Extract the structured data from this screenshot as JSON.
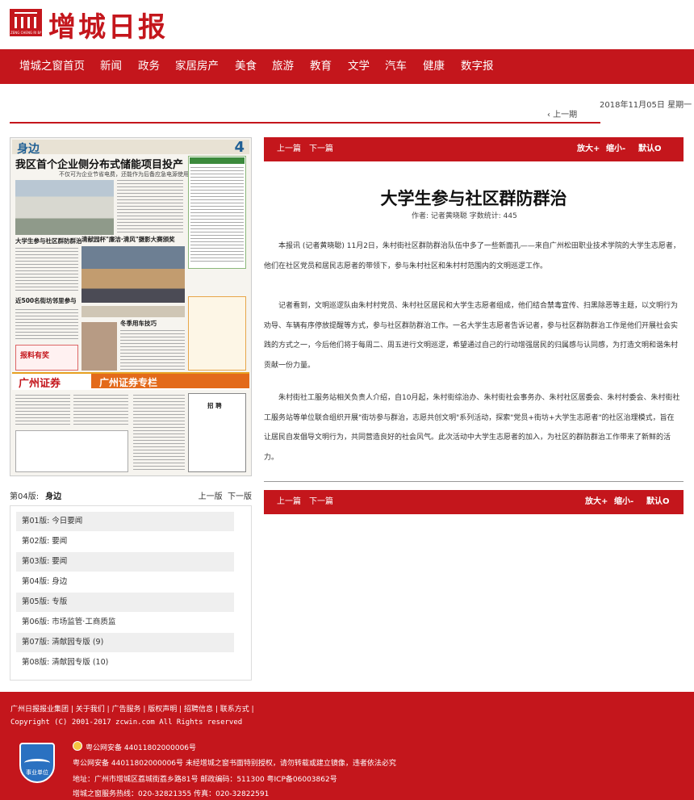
{
  "logo": {
    "title": "增城日报",
    "sub": "ZENG CHENG RI BAO"
  },
  "nav": [
    "增城之窗首页",
    "新闻",
    "政务",
    "家居房产",
    "美食",
    "旅游",
    "教育",
    "文学",
    "汽车",
    "健康",
    "数字报"
  ],
  "date": "2018年11月05日 星期一",
  "prev_issue": "‹ 上一期",
  "paper": {
    "section": "身边",
    "page_num": "4",
    "headline": "我区首个企业侧分布式储能项目投产",
    "subhead": "不仅可为企业节省电费，还能作为后备应急电源使用",
    "t1": "大学生参与社区群防群治",
    "t2": "清献园杯\"廉洁·清风\"摄影大赛颁奖",
    "t3": "近500名街坊邻里参与",
    "t4": "冬季用车技巧",
    "t5": "广州证券",
    "t6": "广州证券专栏",
    "t7": "招 聘",
    "t8": "报料有奖"
  },
  "paper_meta": {
    "edition_label": "第04版:",
    "edition_name": "身边",
    "prev": "上一版",
    "next": "下一版"
  },
  "editions": [
    "第01版: 今日要闻",
    "第02版: 要闻",
    "第03版: 要闻",
    "第04版: 身边",
    "第05版: 专版",
    "第06版: 市场监管·工商质监",
    "第07版: 清献园专版 (9)",
    "第08版: 清献园专版 (10)"
  ],
  "toolbar": {
    "prev_article": "上一篇",
    "next_article": "下一篇",
    "zoom_in": "放大+",
    "zoom_out": "缩小-",
    "default": "默认O"
  },
  "article": {
    "title": "大学生参与社区群防群治",
    "byline": "作者: 记者黄晓聪 字数统计: 445",
    "p1": "本报讯 (记者黄晓聪) 11月2日，朱村街社区群防群治队伍中多了一些新面孔——来自广州松田职业技术学院的大学生志愿者，他们在社区党员和居民志愿者的带领下，参与朱村社区和朱村村范围内的文明巡逻工作。",
    "p2": "记者看到，文明巡逻队由朱村村党员、朱村社区居民和大学生志愿者组成，他们结合禁毒宣传、扫黑除恶等主题，以文明行为劝导、车辆有序停放提醒等方式，参与社区群防群治工作。一名大学生志愿者告诉记者，参与社区群防群治工作是他们开展社会实践的方式之一，今后他们将于每周二、周五进行文明巡逻，希望通过自己的行动增强居民的归属感与认同感，为打造文明和谐朱村贡献一份力量。",
    "p3": "朱村街社工服务站相关负责人介绍，自10月起，朱村街综治办、朱村街社会事务办、朱村社区居委会、朱村村委会、朱村街社工服务站等单位联合组织开展\"街坊参与群治，志愿共创文明\"系列活动，探索\"党员+街坊+大学生志愿者\"的社区治理模式，旨在让居民自发倡导文明行为，共同营造良好的社会风气。此次活动中大学生志愿者的加入，为社区的群防群治工作带来了新鲜的活力。"
  },
  "footer": {
    "links": "广州日报报业集团 | 关于我们 | 广告服务 | 版权声明 | 招聘信息 | 联系方式 |",
    "copyright": "Copyright (C) 2001-2017 zcwin.com All Rights reserved",
    "badge": "事业单位",
    "police": "粤公网安备 44011802000006号",
    "l1": "粤公网安备 44011802000006号 未经增城之窗书面特别授权，请勿转载或建立镜像，违者依法必究",
    "l2": "地址：广州市增城区荔城街荔乡路81号 邮政编码：511300 粤ICP备06003862号",
    "l3": "增城之窗服务热线：020-32821355 传真：020-32822591"
  },
  "colors": {
    "brand_red": "#c4161c"
  }
}
